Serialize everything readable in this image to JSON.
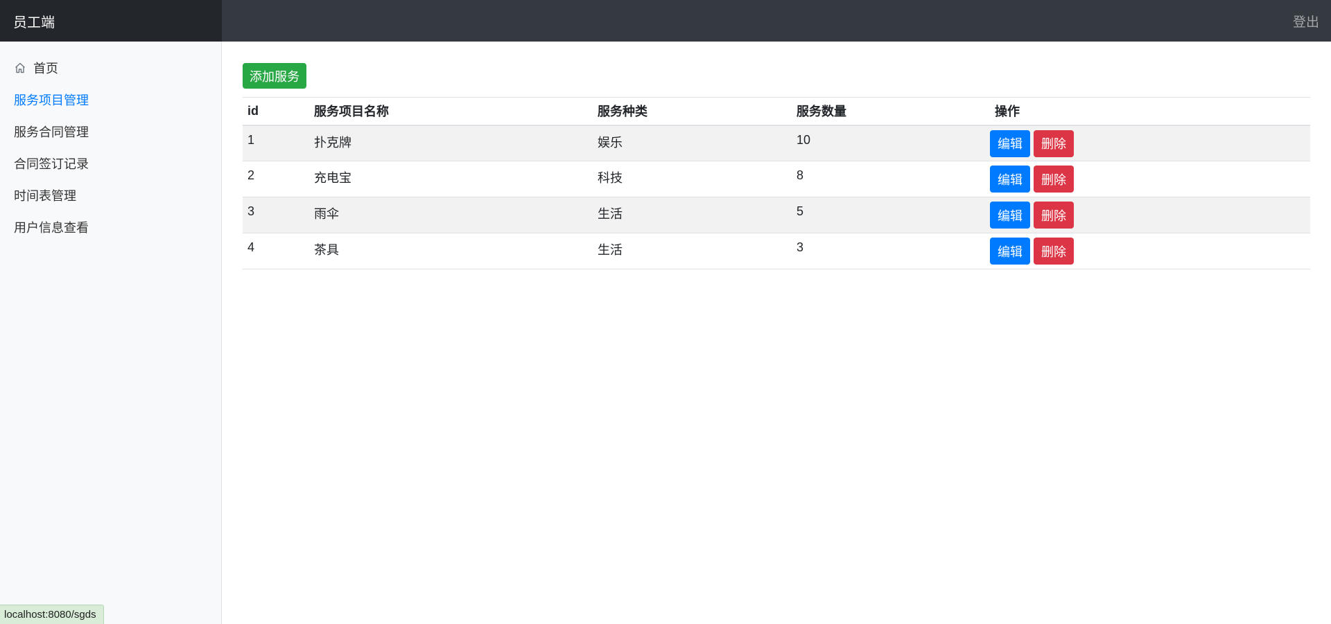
{
  "navbar": {
    "brand": "员工端",
    "logout_label": "登出"
  },
  "sidebar": {
    "items": [
      {
        "label": "首页",
        "icon": "home-icon",
        "active": false
      },
      {
        "label": "服务项目管理",
        "active": true
      },
      {
        "label": "服务合同管理",
        "active": false
      },
      {
        "label": "合同签订记录",
        "active": false
      },
      {
        "label": "时间表管理",
        "active": false
      },
      {
        "label": "用户信息查看",
        "active": false
      }
    ]
  },
  "main": {
    "add_button_label": "添加服务",
    "table": {
      "headers": [
        "id",
        "服务项目名称",
        "服务种类",
        "服务数量",
        "操作"
      ],
      "rows": [
        {
          "id": "1",
          "name": "扑克牌",
          "kind": "娱乐",
          "count": "10"
        },
        {
          "id": "2",
          "name": "充电宝",
          "kind": "科技",
          "count": "8"
        },
        {
          "id": "3",
          "name": "雨伞",
          "kind": "生活",
          "count": "5"
        },
        {
          "id": "4",
          "name": "茶具",
          "kind": "生活",
          "count": "3"
        }
      ],
      "edit_label": "编辑",
      "delete_label": "删除"
    }
  },
  "status_bar": {
    "url": "localhost:8080/sgds"
  },
  "colors": {
    "navbar": "#343a40",
    "brand_bg": "#23272b",
    "active_link": "#007bff",
    "success": "#28a745",
    "primary": "#007bff",
    "danger": "#dc3545"
  }
}
